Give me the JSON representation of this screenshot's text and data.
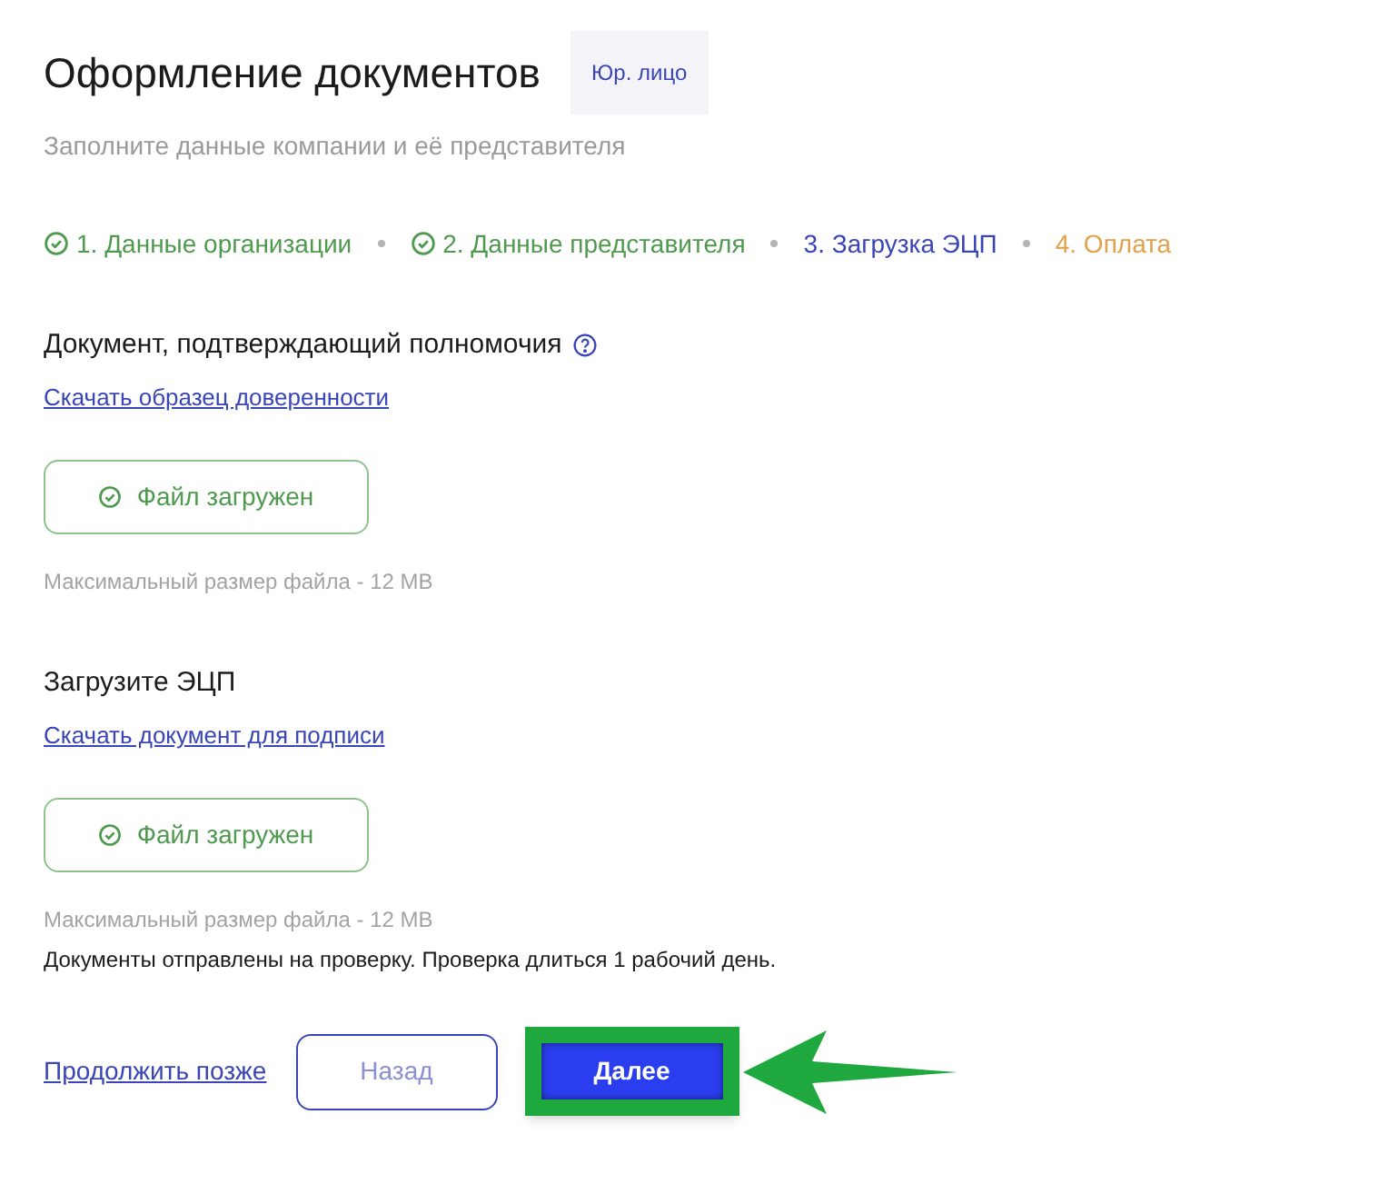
{
  "header": {
    "title": "Оформление документов",
    "badge": "Юр. лицо",
    "subtitle": "Заполните данные компании и её представителя"
  },
  "steps": [
    {
      "label": "1. Данные организации",
      "completed": true,
      "selected": false
    },
    {
      "label": "2. Данные представителя",
      "completed": true,
      "selected": false
    },
    {
      "label": "3. Загрузка ЭЦП",
      "completed": false,
      "selected": true
    },
    {
      "label": "4. Оплата",
      "completed": false,
      "selected": false
    }
  ],
  "sections": [
    {
      "heading": "Документ, подтверждающий полномочия",
      "help": true,
      "link": "Скачать образец доверенности",
      "upload": {
        "label": "Файл загружен",
        "uploaded": true
      },
      "hint": "Максимальный размер файла - 12 MB"
    },
    {
      "heading": "Загрузите ЭЦП",
      "help": false,
      "link": "Скачать документ для подписи",
      "upload": {
        "label": "Файл загружен",
        "uploaded": true
      },
      "hint": "Максимальный размер файла - 12 MB"
    }
  ],
  "notice": "Документы отправлены на проверку. Проверка длиться 1 рабочий день.",
  "footer": {
    "later_link": "Продолжить позже",
    "back_button": "Назад",
    "next_button": {
      "label": "Далее",
      "highlighted": true
    }
  }
}
